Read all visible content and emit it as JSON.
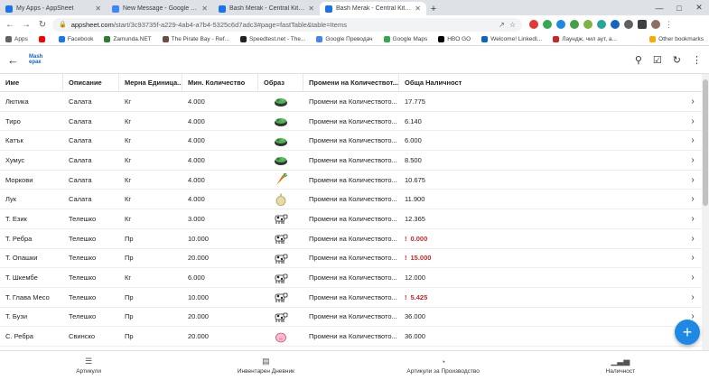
{
  "browser": {
    "tabs": [
      {
        "title": "My Apps - AppSheet",
        "fav_color": "#1a73e8",
        "active": false
      },
      {
        "title": "New Message - Google Cloud Co",
        "fav_color": "#4285f4",
        "active": false
      },
      {
        "title": "Bash Merak - Central Kitchen - A",
        "fav_color": "#1a73e8",
        "active": false
      },
      {
        "title": "Bash Merak - Central Kitchen",
        "fav_color": "#1a73e8",
        "active": true
      }
    ],
    "new_tab": "+",
    "url_host": "appsheet.com",
    "url_path": "/start/3c93735f-a229-4ab4-a7b4-5325c6d7adc3#page=fastTable&table=Items"
  },
  "bookmarks": [
    {
      "label": "Apps",
      "color": "#5f6368"
    },
    {
      "label": "",
      "color": "#ff0000"
    },
    {
      "label": "Facebook",
      "color": "#1877f2"
    },
    {
      "label": "Zamunda.NET",
      "color": "#2e7d32"
    },
    {
      "label": "The Pirate Bay - Ref...",
      "color": "#6d4c41"
    },
    {
      "label": "Speedtest.net - The...",
      "color": "#212121"
    },
    {
      "label": "Google Преводач",
      "color": "#4285f4"
    },
    {
      "label": "Google Maps",
      "color": "#34a853"
    },
    {
      "label": "HBO GO",
      "color": "#000000"
    },
    {
      "label": "Welcome! LinkedI...",
      "color": "#0a66c2"
    },
    {
      "label": "Лаундж, чил аут, а...",
      "color": "#c62828"
    }
  ],
  "other_bookmarks": "Other bookmarks",
  "app": {
    "logo_top": "Mash",
    "logo_bottom": "ерак"
  },
  "table": {
    "headers": [
      "Име",
      "Описание",
      "Мерна Единица...",
      "Мин. Количество",
      "Образ",
      "Промени на Количествот...",
      "Обща Наличност"
    ],
    "action_label": "Промени на Количеството...",
    "rows": [
      {
        "name": "Лютика",
        "desc": "Салата",
        "unit": "Кг",
        "min": "4.000",
        "img": "salad",
        "total": "17.775",
        "neg": false
      },
      {
        "name": "Тиро",
        "desc": "Салата",
        "unit": "Кг",
        "min": "4.000",
        "img": "salad",
        "total": "6.140",
        "neg": false
      },
      {
        "name": "Катък",
        "desc": "Салата",
        "unit": "Кг",
        "min": "4.000",
        "img": "salad",
        "total": "6.000",
        "neg": false
      },
      {
        "name": "Хумус",
        "desc": "Салата",
        "unit": "Кг",
        "min": "4.000",
        "img": "salad",
        "total": "8.500",
        "neg": false
      },
      {
        "name": "Моркови",
        "desc": "Салата",
        "unit": "Кг",
        "min": "4.000",
        "img": "carrot",
        "total": "10.675",
        "neg": false
      },
      {
        "name": "Лук",
        "desc": "Салата",
        "unit": "Кг",
        "min": "4.000",
        "img": "onion",
        "total": "11.900",
        "neg": false
      },
      {
        "name": "Т. Език",
        "desc": "Телешко",
        "unit": "Кг",
        "min": "3.000",
        "img": "cow",
        "total": "12.365",
        "neg": false
      },
      {
        "name": "Т. Ребра",
        "desc": "Телешко",
        "unit": "Пр",
        "min": "10.000",
        "img": "cow",
        "total": "0.000",
        "neg": true
      },
      {
        "name": "Т. Опашки",
        "desc": "Телешко",
        "unit": "Пр",
        "min": "20.000",
        "img": "cow",
        "total": "15.000",
        "neg": true
      },
      {
        "name": "Т. Шкембе",
        "desc": "Телешко",
        "unit": "Кг",
        "min": "6.000",
        "img": "cow",
        "total": "12.000",
        "neg": false
      },
      {
        "name": "Т. Глава Месо",
        "desc": "Телешко",
        "unit": "Пр",
        "min": "10.000",
        "img": "cow",
        "total": "5.425",
        "neg": true
      },
      {
        "name": "Т. Бузи",
        "desc": "Телешко",
        "unit": "Пр",
        "min": "20.000",
        "img": "cow",
        "total": "36.000",
        "neg": false
      },
      {
        "name": "С. Ребра",
        "desc": "Свинско",
        "unit": "Пр",
        "min": "20.000",
        "img": "pig",
        "total": "36.000",
        "neg": false
      }
    ]
  },
  "fab": "+",
  "bottom_nav": [
    {
      "label": "Артикули",
      "icon": "list-icon"
    },
    {
      "label": "Инвентарен Дневник",
      "icon": "journal-icon"
    },
    {
      "label": "Артикули за Производство",
      "icon": "production-icon"
    },
    {
      "label": "Наличност",
      "icon": "bar-chart-icon"
    }
  ]
}
